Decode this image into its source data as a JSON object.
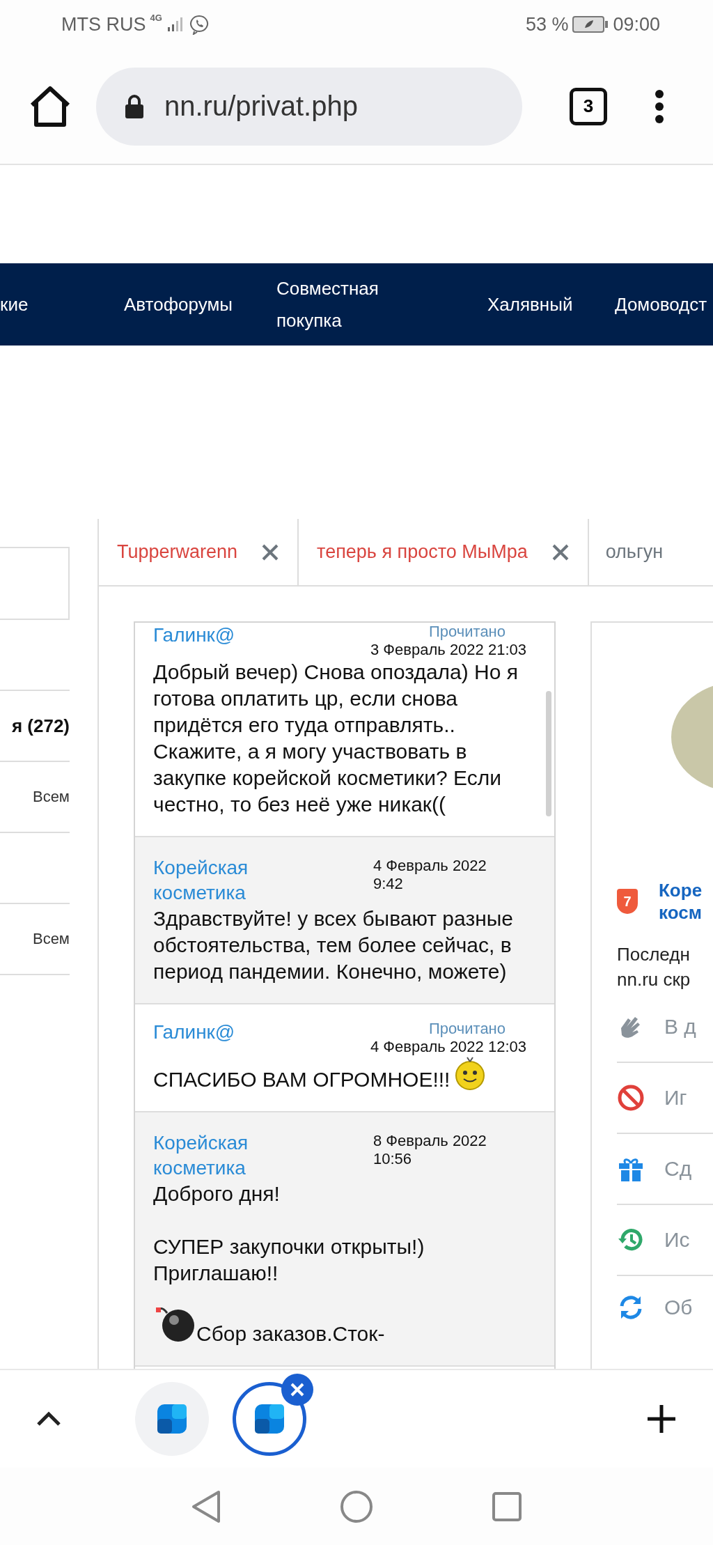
{
  "status_bar": {
    "carrier": "MTS RUS",
    "network": "4G",
    "battery": "53 %",
    "time": "09:00"
  },
  "browser": {
    "url": "nn.ru/privat.php",
    "tab_count": "3"
  },
  "nav": {
    "items": [
      {
        "label": "кие"
      },
      {
        "label": "Автофорумы"
      },
      {
        "label": "Совместная покупка"
      },
      {
        "label": "Халявный"
      },
      {
        "label": "Домоводст"
      }
    ]
  },
  "sidebar": {
    "heading": "я (272)",
    "items": [
      {
        "label": "Всем"
      },
      {
        "label": "Всем"
      }
    ]
  },
  "tabs": [
    {
      "label": "Tupperwarenn",
      "unread": true,
      "closable": true
    },
    {
      "label": "теперь я просто МыМра",
      "unread": true,
      "closable": true
    },
    {
      "label": "ольгун",
      "unread": false,
      "closable": false
    }
  ],
  "messages": [
    {
      "kind": "outgoing",
      "author": "Галинк@",
      "status": "Прочитано",
      "date": "3 Февраль 2022 21:03",
      "paragraphs": [
        {
          "parts": [
            {
              "kind": "text",
              "text": "Добрый вечер) Снова опоздала) Но я готова оплатить цр, если снова придётся его туда отправлять.. Скажите, а я могу участвовать в закупке корейской косметики? Если честно, то без неё уже никак(("
            }
          ]
        }
      ]
    },
    {
      "kind": "incoming",
      "author": "Корейская косметика",
      "date": "4 Февраль 2022 9:42",
      "paragraphs": [
        {
          "parts": [
            {
              "kind": "text",
              "text": "Здравствуйте! у всех бывают разные обстоятельства, тем более сейчас, в период пандемии. Конечно, можете)"
            }
          ]
        }
      ]
    },
    {
      "kind": "outgoing",
      "author": "Галинк@",
      "status": "Прочитано",
      "date": "4 Февраль 2022 12:03",
      "paragraphs": [
        {
          "parts": [
            {
              "kind": "text",
              "text": "СПАСИБО ВАМ ОГРОМНОЕ!!!"
            },
            {
              "kind": "smiley"
            }
          ]
        }
      ]
    },
    {
      "kind": "incoming",
      "author": "Корейская косметика",
      "date": "8 Февраль 2022 10:56",
      "paragraphs": [
        {
          "parts": [
            {
              "kind": "text",
              "text": "Доброго дня!"
            }
          ]
        },
        {
          "parts": [
            {
              "kind": "text",
              "text": "СУПЕР закупочки открыты!)"
            }
          ]
        },
        {
          "parts": [
            {
              "kind": "text",
              "text": "Приглашаю!!"
            }
          ]
        },
        {
          "parts": [
            {
              "kind": "bomb"
            },
            {
              "kind": "text",
              "text": "Сбор заказов.Сток-"
            }
          ]
        }
      ]
    }
  ],
  "profile": {
    "badge": "7",
    "name_lines": [
      "Коре",
      "косм"
    ],
    "note_lines": [
      "Последн",
      "nn.ru скр"
    ],
    "actions": [
      {
        "kind": "hand",
        "label": "В д"
      },
      {
        "kind": "ban",
        "label": "Иг"
      },
      {
        "kind": "gift",
        "label": "Сд"
      },
      {
        "kind": "history",
        "label": "Ис"
      },
      {
        "kind": "refresh",
        "label": "Об"
      }
    ]
  }
}
